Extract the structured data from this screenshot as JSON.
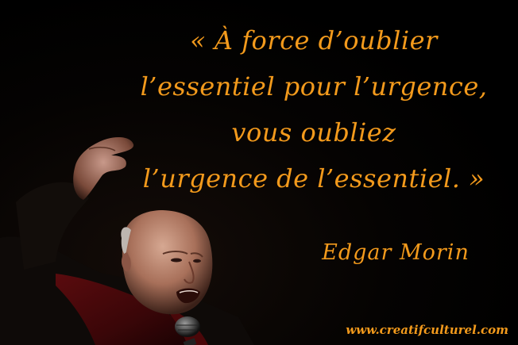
{
  "colors": {
    "text": "#f39a1c",
    "background": "#000000"
  },
  "quote": {
    "lines": [
      "« À force d’oublier",
      "l’essentiel pour l’urgence,",
      "vous oubliez",
      "l’urgence de l’essentiel. »"
    ]
  },
  "author": "Edgar Morin",
  "website": "www.creatifculturel.com",
  "photo": {
    "subject": "elderly man speaking into a microphone with raised hand"
  }
}
